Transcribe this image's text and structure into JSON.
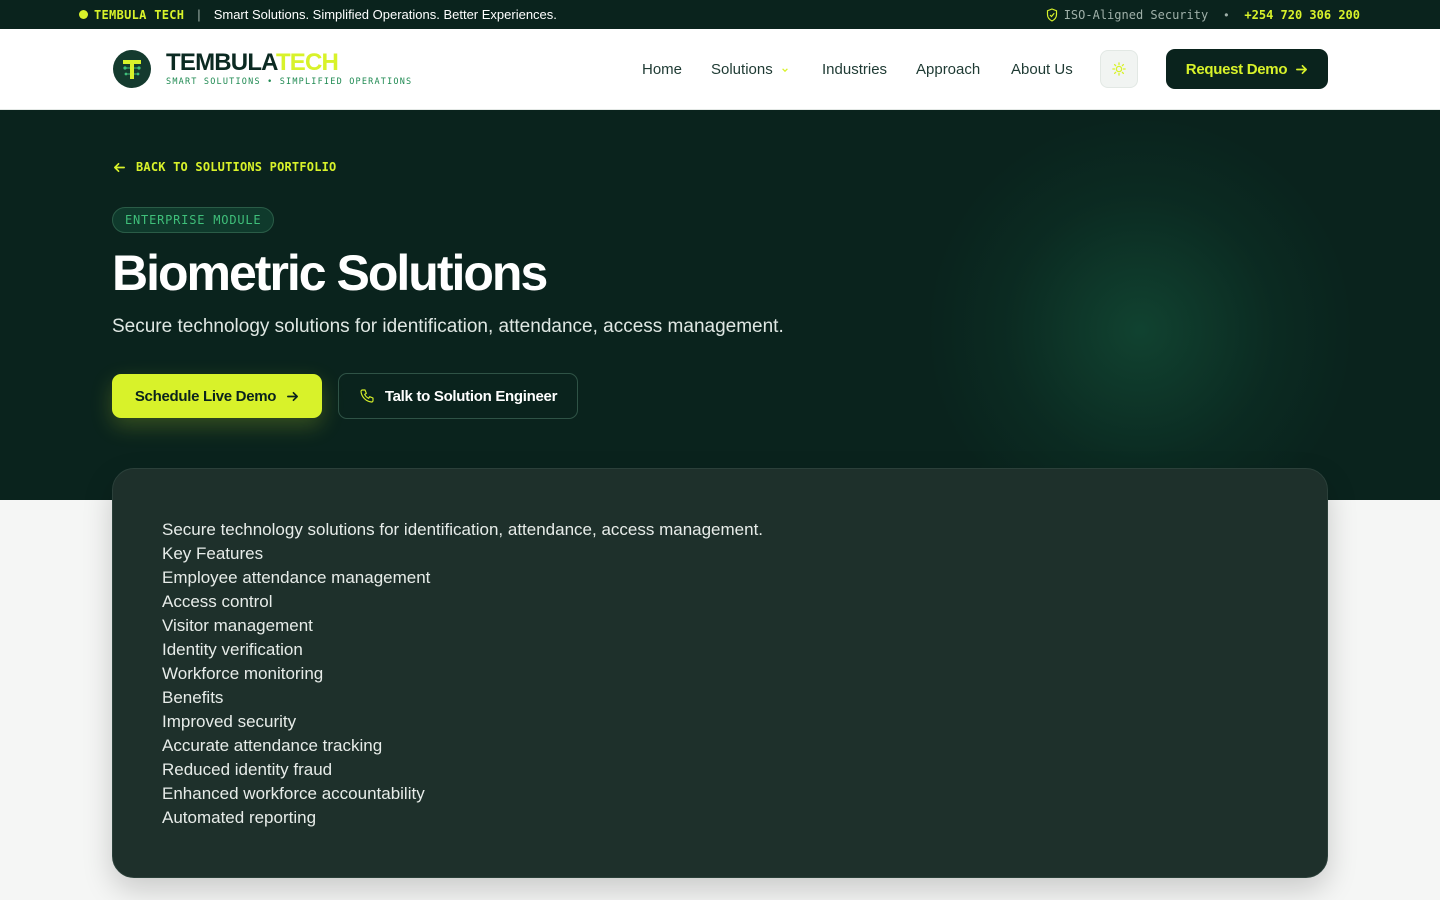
{
  "topbar": {
    "brand": "TEMBULA TECH",
    "separator": "|",
    "tagline": "Smart Solutions. Simplified Operations. Better Experiences.",
    "security": "ISO-Aligned Security",
    "bullet": "•",
    "phone": "+254 720 306 200"
  },
  "header": {
    "logo_word_a": "TEMBULA",
    "logo_word_b": "TECH",
    "logo_sub": "SMART SOLUTIONS • SIMPLIFIED OPERATIONS",
    "nav": {
      "home": "Home",
      "solutions": "Solutions",
      "industries": "Industries",
      "approach": "Approach",
      "about": "About Us"
    },
    "request_demo": "Request Demo"
  },
  "hero": {
    "back_link": "BACK TO SOLUTIONS PORTFOLIO",
    "badge": "ENTERPRISE MODULE",
    "title": "Biometric Solutions",
    "subtitle": "Secure technology solutions for identification, attendance, access management.",
    "primary_cta": "Schedule Live Demo",
    "secondary_cta": "Talk to Solution Engineer"
  },
  "content": {
    "lines": [
      "Secure technology solutions for identification, attendance, access management.",
      "Key Features",
      "Employee attendance management",
      "Access control",
      "Visitor management",
      "Identity verification",
      "Workforce monitoring",
      "Benefits",
      "Improved security",
      "Accurate attendance tracking",
      "Reduced identity fraud",
      "Enhanced workforce accountability",
      "Automated reporting"
    ]
  },
  "colors": {
    "accent": "#d8f22a",
    "dark": "#0a231d",
    "card": "#1e302b"
  }
}
